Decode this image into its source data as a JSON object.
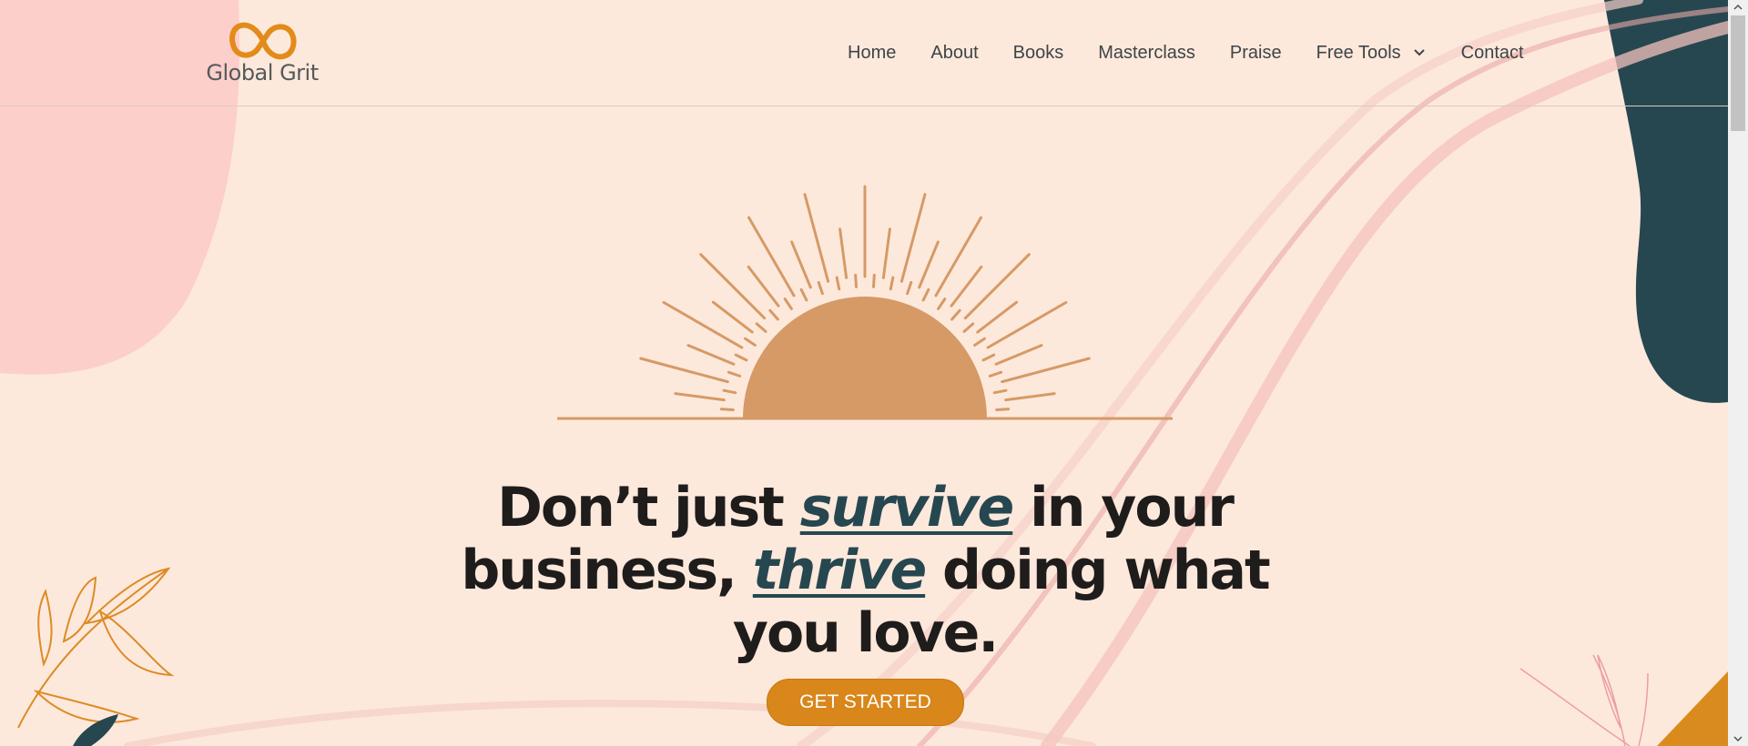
{
  "brand": {
    "name": "Global Grit",
    "logo_icon": "infinity-icon",
    "accent": "#e38b1a"
  },
  "nav": {
    "items": [
      {
        "label": "Home"
      },
      {
        "label": "About"
      },
      {
        "label": "Books"
      },
      {
        "label": "Masterclass"
      },
      {
        "label": "Praise"
      },
      {
        "label": "Free Tools",
        "has_dropdown": true,
        "icon": "chevron-down-icon"
      },
      {
        "label": "Contact"
      }
    ]
  },
  "hero": {
    "illustration": "sunrise-illustration",
    "headline": {
      "part1": "Don’t just ",
      "em1": "survive",
      "part2": " in your business, ",
      "em2": "thrive",
      "part3": " doing what you love."
    },
    "cta_label": "GET STARTED"
  },
  "colors": {
    "background": "#fde9dc",
    "pink_blob": "#fccfcb",
    "teal_blob": "#264750",
    "sun": "#d69a66",
    "button": "#d9861a",
    "headline": "#1f1c1c",
    "headline_emphasis": "#264750"
  }
}
